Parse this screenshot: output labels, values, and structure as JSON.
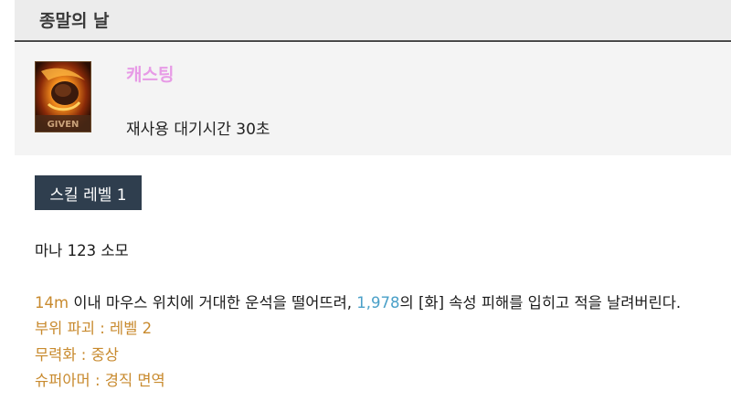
{
  "skill": {
    "name": "종말의 날",
    "cast_type": "캐스팅",
    "cooldown": "재사용 대기시간 30초",
    "icon": "meteor-icon",
    "icon_caption": "GIVEN",
    "level_label": "스킬 레벨 1",
    "mana": "마나 123 소모",
    "description": {
      "range": "14m",
      "part1": " 이내 마우스 위치에 거대한 운석을 떨어뜨려, ",
      "damage": "1,978",
      "part2": "의 [화] 속성 피해를 입히고 적을 날려버린다."
    },
    "effects": [
      "부위 파괴 : 레벨 2",
      "무력화 : 중상",
      "슈퍼아머 : 경직 면역"
    ]
  },
  "colors": {
    "cast_type": "#e79be6",
    "highlight_orange": "#c88a2e",
    "highlight_blue": "#4aa0c8",
    "level_badge_bg": "#2f3e4e"
  }
}
